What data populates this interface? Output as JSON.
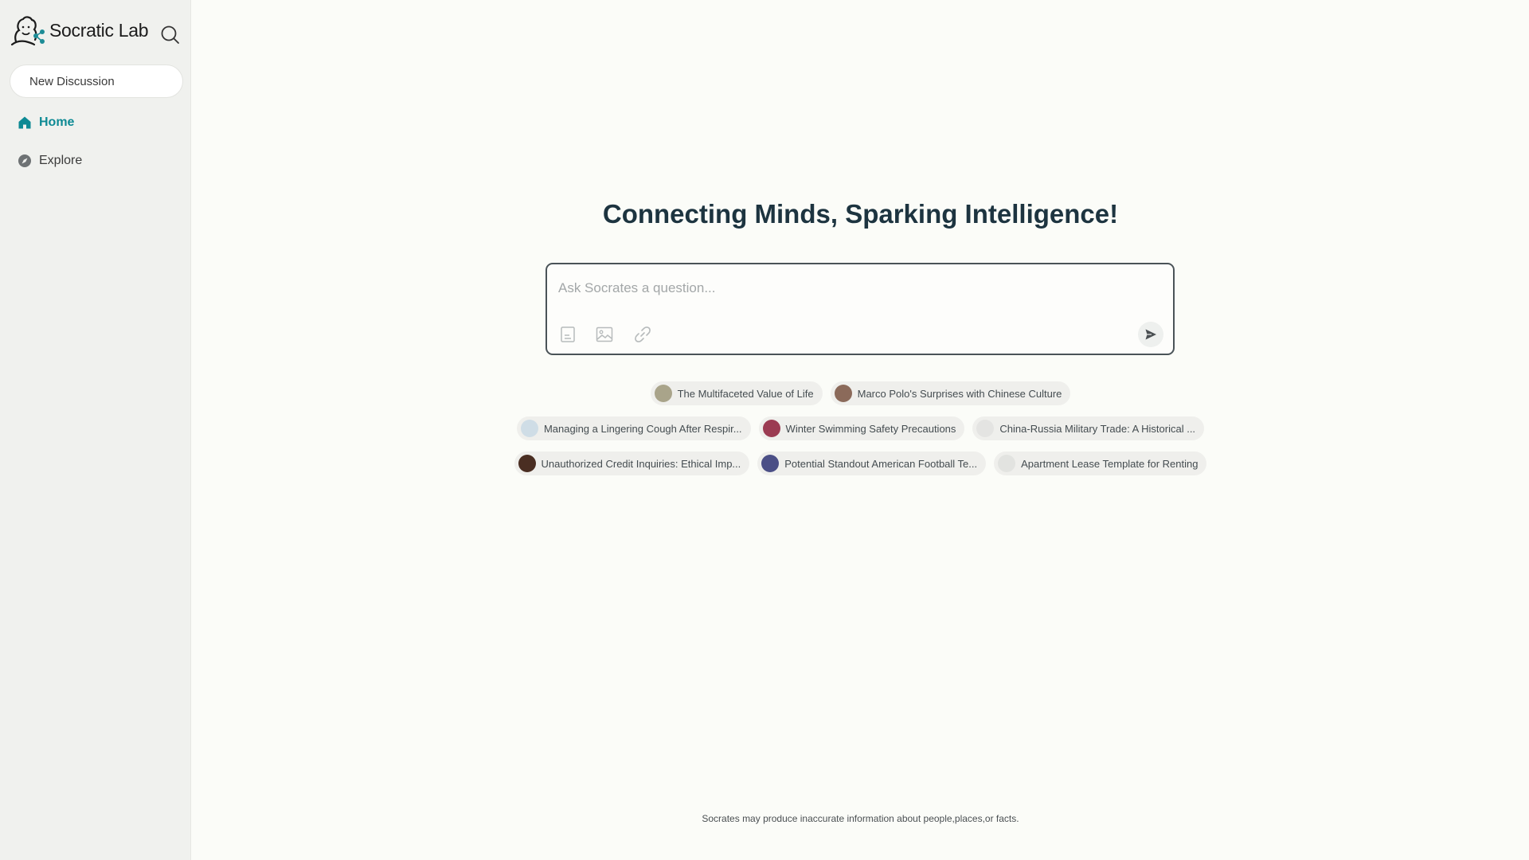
{
  "sidebar": {
    "brand_name": "Socratic Lab",
    "brand_icon": "socrates-bust-logo",
    "search_icon": "search-icon",
    "new_discussion_label": "New Discussion",
    "nav": [
      {
        "label": "Home",
        "icon": "home-icon",
        "active": true
      },
      {
        "label": "Explore",
        "icon": "compass-icon",
        "active": false
      }
    ]
  },
  "main": {
    "hero_title": "Connecting Minds, Sparking Intelligence!",
    "ask": {
      "placeholder": "Ask Socrates a question...",
      "value": "",
      "tools": [
        "document-icon",
        "image-icon",
        "link-icon"
      ],
      "send_icon": "send-icon"
    },
    "suggestions": [
      [
        {
          "label": "The Multifaceted Value of Life",
          "thumb_color": "#a9a48a"
        },
        {
          "label": "Marco Polo's Surprises with Chinese Culture",
          "thumb_color": "#8b6a5a"
        }
      ],
      [
        {
          "label": "Managing a Lingering Cough After Respir...",
          "thumb_color": "#cfdde6"
        },
        {
          "label": "Winter Swimming Safety Precautions",
          "thumb_color": "#9b3b52"
        },
        {
          "label": "China-Russia Military Trade: A Historical ...",
          "thumb_color": "#e4e4e2"
        }
      ],
      [
        {
          "label": "Unauthorized Credit Inquiries: Ethical Imp...",
          "thumb_color": "#4a2e22"
        },
        {
          "label": "Potential Standout American Football Te...",
          "thumb_color": "#4b4f86"
        },
        {
          "label": "Apartment Lease Template for Renting",
          "thumb_color": "#e2e3e0"
        }
      ]
    ],
    "disclaimer": "Socrates may produce inaccurate information about people,places,or facts."
  },
  "colors": {
    "accent": "#0e8a94",
    "sidebar_bg": "#f0f1ee",
    "main_bg": "#fbfcf8",
    "title": "#1d3440"
  }
}
